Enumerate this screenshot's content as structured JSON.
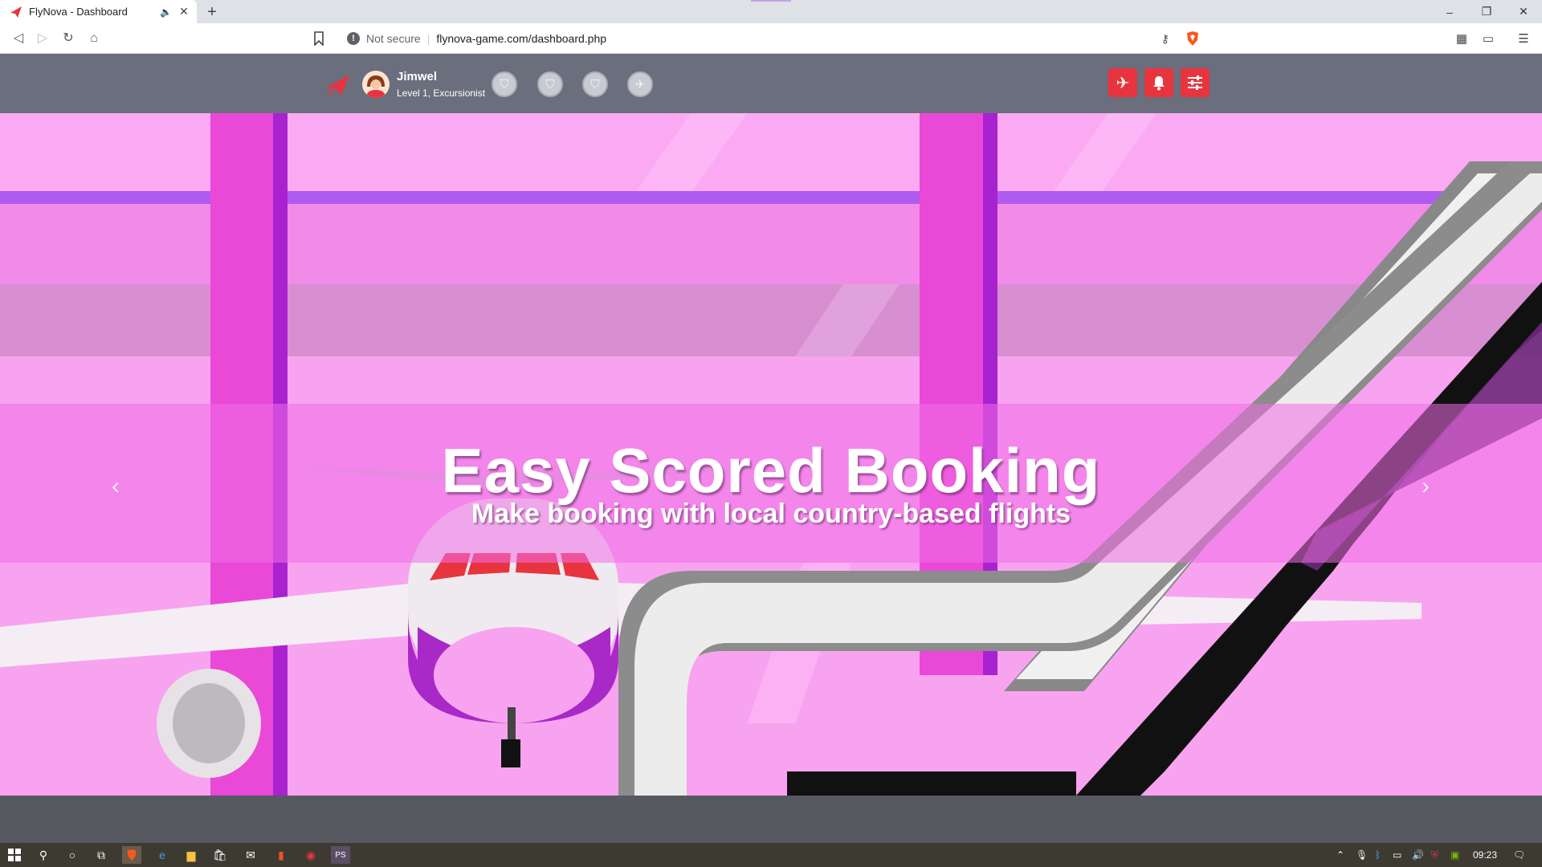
{
  "browser": {
    "tab_title": "FlyNova - Dashboard",
    "new_tab": "+",
    "security_label": "Not secure",
    "url": "flynova-game.com/dashboard.php",
    "window_controls": {
      "minimize": "–",
      "restore": "❐",
      "close": "✕"
    }
  },
  "header": {
    "username": "Jimwel",
    "level": "Level 1, Excursionist",
    "badges": [
      "badge-1",
      "badge-2",
      "badge-3",
      "badge-4"
    ],
    "actions": [
      "flights",
      "notifications",
      "menu"
    ]
  },
  "hero": {
    "title": "Easy Scored Booking",
    "subtitle": "Make booking with local country-based flights",
    "prev": "‹",
    "next": "›"
  },
  "taskbar": {
    "time": "09:23"
  },
  "colors": {
    "accent": "#e8343e",
    "header_bg": "#6b6e7d",
    "hero_pink": "#f7a2f0",
    "pillar": "#ea48d6"
  }
}
